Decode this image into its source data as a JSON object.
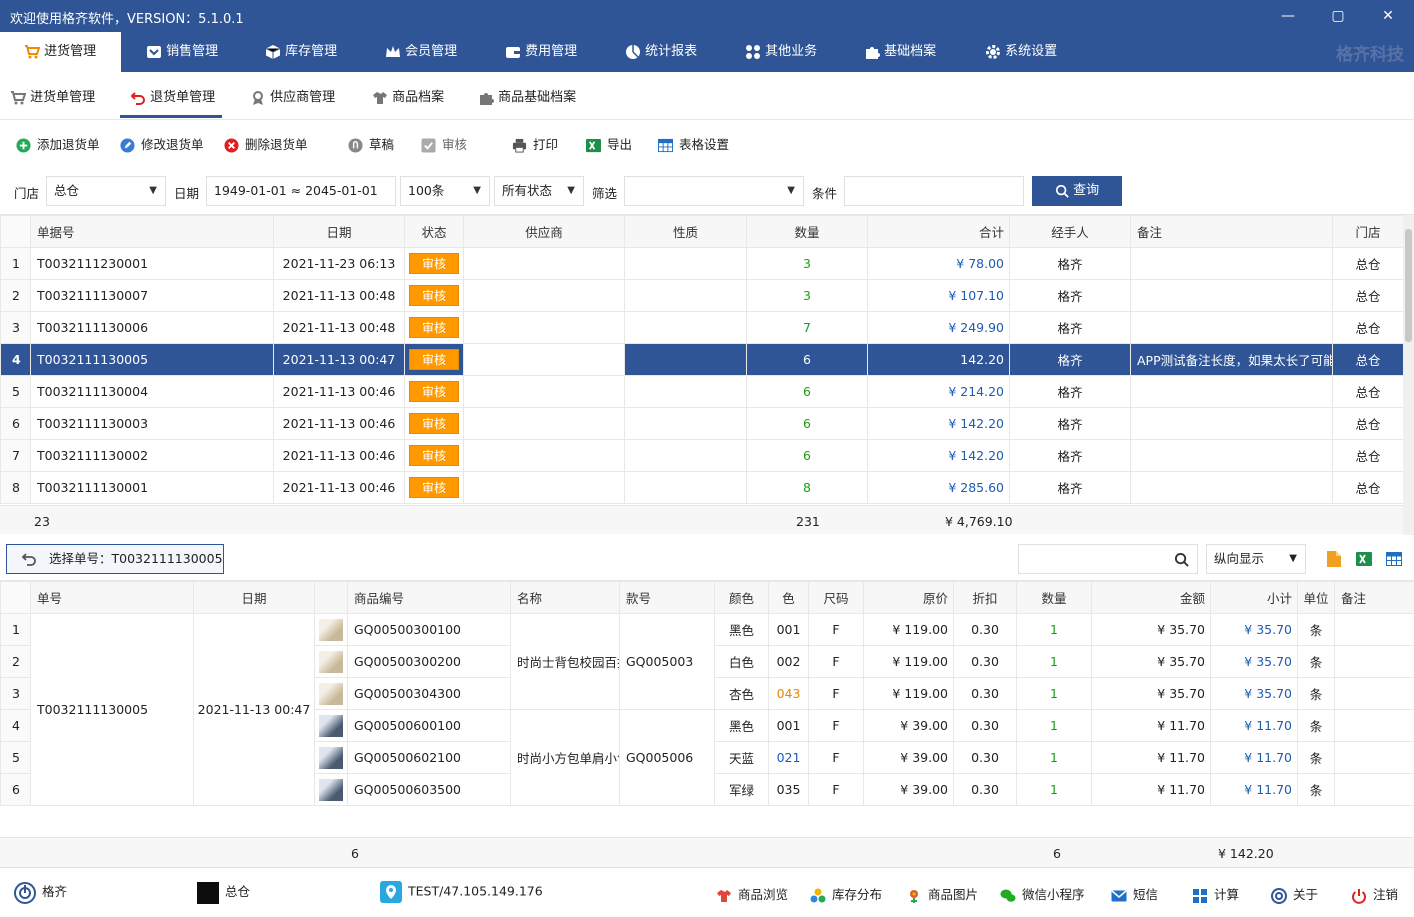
{
  "window": {
    "title": "欢迎使用格齐软件，VERSION：5.1.0.1"
  },
  "main_nav": {
    "items": [
      "进货管理",
      "销售管理",
      "库存管理",
      "会员管理",
      "费用管理",
      "统计报表",
      "其他业务",
      "基础档案",
      "系统设置"
    ],
    "brand": "格齐科技"
  },
  "sub_nav": {
    "items": [
      "进货单管理",
      "退货单管理",
      "供应商管理",
      "商品档案",
      "商品基础档案"
    ]
  },
  "toolbar": {
    "items": [
      "添加退货单",
      "修改退货单",
      "删除退货单",
      "草稿",
      "审核",
      "打印",
      "导出",
      "表格设置"
    ]
  },
  "filter": {
    "store_label": "门店",
    "store_value": "总仓",
    "date_label": "日期",
    "date_value": "1949-01-01 ≈ 2045-01-01",
    "count_value": "100条",
    "status_value": "所有状态",
    "screen_label": "筛选",
    "screen_value": "",
    "cond_label": "条件",
    "cond_value": "",
    "query_label": "查询"
  },
  "orders": {
    "columns": [
      "单据号",
      "日期",
      "状态",
      "供应商",
      "性质",
      "数量",
      "合计",
      "经手人",
      "备注",
      "门店"
    ],
    "rows": [
      {
        "no": "1",
        "id": "T0032111230001",
        "date": "2021-11-23 06:13",
        "status": "审核",
        "supplier": "",
        "nature": "",
        "qty": "3",
        "total": "¥ 78.00",
        "handler": "格齐",
        "note": "",
        "store": "总仓"
      },
      {
        "no": "2",
        "id": "T0032111130007",
        "date": "2021-11-13 00:48",
        "status": "审核",
        "supplier": "",
        "nature": "",
        "qty": "3",
        "total": "¥ 107.10",
        "handler": "格齐",
        "note": "",
        "store": "总仓"
      },
      {
        "no": "3",
        "id": "T0032111130006",
        "date": "2021-11-13 00:48",
        "status": "审核",
        "supplier": "",
        "nature": "",
        "qty": "7",
        "total": "¥ 249.90",
        "handler": "格齐",
        "note": "",
        "store": "总仓"
      },
      {
        "no": "4",
        "id": "T0032111130005",
        "date": "2021-11-13 00:47",
        "status": "审核",
        "supplier": "",
        "nature": "",
        "qty": "6",
        "total": "142.20",
        "handler": "格齐",
        "note": "APP测试备注长度，如果太长了可能显示不全",
        "store": "总仓"
      },
      {
        "no": "5",
        "id": "T0032111130004",
        "date": "2021-11-13 00:46",
        "status": "审核",
        "supplier": "",
        "nature": "",
        "qty": "6",
        "total": "¥ 214.20",
        "handler": "格齐",
        "note": "",
        "store": "总仓"
      },
      {
        "no": "6",
        "id": "T0032111130003",
        "date": "2021-11-13 00:46",
        "status": "审核",
        "supplier": "",
        "nature": "",
        "qty": "6",
        "total": "¥ 142.20",
        "handler": "格齐",
        "note": "",
        "store": "总仓"
      },
      {
        "no": "7",
        "id": "T0032111130002",
        "date": "2021-11-13 00:46",
        "status": "审核",
        "supplier": "",
        "nature": "",
        "qty": "6",
        "total": "¥ 142.20",
        "handler": "格齐",
        "note": "",
        "store": "总仓"
      },
      {
        "no": "8",
        "id": "T0032111130001",
        "date": "2021-11-13 00:46",
        "status": "审核",
        "supplier": "",
        "nature": "",
        "qty": "8",
        "total": "¥ 285.60",
        "handler": "格齐",
        "note": "",
        "store": "总仓"
      }
    ],
    "summary": {
      "count": "23",
      "qty": "231",
      "total": "¥ 4,769.10"
    }
  },
  "selection": {
    "label": "选择单号：T0032111130005",
    "view_mode": "纵向显示",
    "search_value": ""
  },
  "details": {
    "columns": [
      "单号",
      "日期",
      "商品编号",
      "名称",
      "款号",
      "颜色",
      "色",
      "尺码",
      "原价",
      "折扣",
      "数量",
      "金额",
      "小计",
      "单位",
      "备注"
    ],
    "order_id": "T0032111130005",
    "order_date": "2021-11-13 00:47",
    "groups": [
      {
        "name": "时尚士背包校园百搭",
        "style": "GQ005003"
      },
      {
        "name": "时尚小方包单肩小包",
        "style": "GQ005006"
      }
    ],
    "rows": [
      {
        "no": "1",
        "code": "GQ00500300100",
        "color": "黑色",
        "cc": "001",
        "size": "F",
        "price": "¥ 119.00",
        "disc": "0.30",
        "qty": "1",
        "amt": "¥ 35.70",
        "sub": "¥ 35.70",
        "unit": "条",
        "note": ""
      },
      {
        "no": "2",
        "code": "GQ00500300200",
        "color": "白色",
        "cc": "002",
        "size": "F",
        "price": "¥ 119.00",
        "disc": "0.30",
        "qty": "1",
        "amt": "¥ 35.70",
        "sub": "¥ 35.70",
        "unit": "条",
        "note": ""
      },
      {
        "no": "3",
        "code": "GQ00500304300",
        "color": "杏色",
        "cc": "043",
        "size": "F",
        "price": "¥ 119.00",
        "disc": "0.30",
        "qty": "1",
        "amt": "¥ 35.70",
        "sub": "¥ 35.70",
        "unit": "条",
        "note": ""
      },
      {
        "no": "4",
        "code": "GQ00500600100",
        "color": "黑色",
        "cc": "001",
        "size": "F",
        "price": "¥ 39.00",
        "disc": "0.30",
        "qty": "1",
        "amt": "¥ 11.70",
        "sub": "¥ 11.70",
        "unit": "条",
        "note": ""
      },
      {
        "no": "5",
        "code": "GQ00500602100",
        "color": "天蓝",
        "cc": "021",
        "size": "F",
        "price": "¥ 39.00",
        "disc": "0.30",
        "qty": "1",
        "amt": "¥ 11.70",
        "sub": "¥ 11.70",
        "unit": "条",
        "note": ""
      },
      {
        "no": "6",
        "code": "GQ00500603500",
        "color": "军绿",
        "cc": "035",
        "size": "F",
        "price": "¥ 39.00",
        "disc": "0.30",
        "qty": "1",
        "amt": "¥ 11.70",
        "sub": "¥ 11.70",
        "unit": "条",
        "note": ""
      }
    ],
    "summary": {
      "count": "6",
      "qty": "6",
      "subtotal": "¥ 142.20"
    }
  },
  "status_bar": {
    "user": "格齐",
    "store": "总仓",
    "server": "TEST/47.105.149.176",
    "actions": [
      "商品浏览",
      "库存分布",
      "商品图片",
      "微信小程序",
      "短信",
      "计算",
      "关于",
      "注销"
    ]
  },
  "colors": {
    "primary": "#2f5597",
    "badge": "#ff9900",
    "qty_green": "#1a9e1a",
    "amount_blue": "#1e5cb3"
  }
}
